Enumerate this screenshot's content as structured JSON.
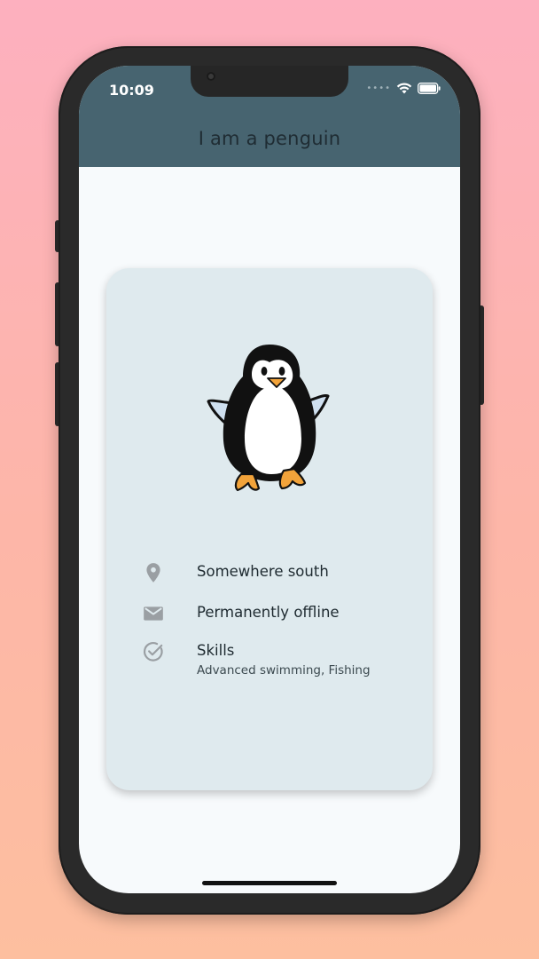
{
  "status_bar": {
    "time": "10:09",
    "icons": [
      "signal-dots-icon",
      "wifi-icon",
      "battery-icon"
    ]
  },
  "app_bar": {
    "title": "I am a penguin",
    "background": "#476470"
  },
  "profile_card": {
    "image": "penguin-illustration",
    "items": [
      {
        "icon": "location-pin-icon",
        "label": "Somewhere south"
      },
      {
        "icon": "mail-icon",
        "label": "Permanently offline"
      },
      {
        "icon": "check-circle-icon",
        "label": "Skills",
        "sublabel": "Advanced swimming, Fishing"
      }
    ]
  },
  "colors": {
    "card_background": "#dfeaee",
    "screen_background": "#f7fafc",
    "icon_color": "#9a9fa3"
  }
}
